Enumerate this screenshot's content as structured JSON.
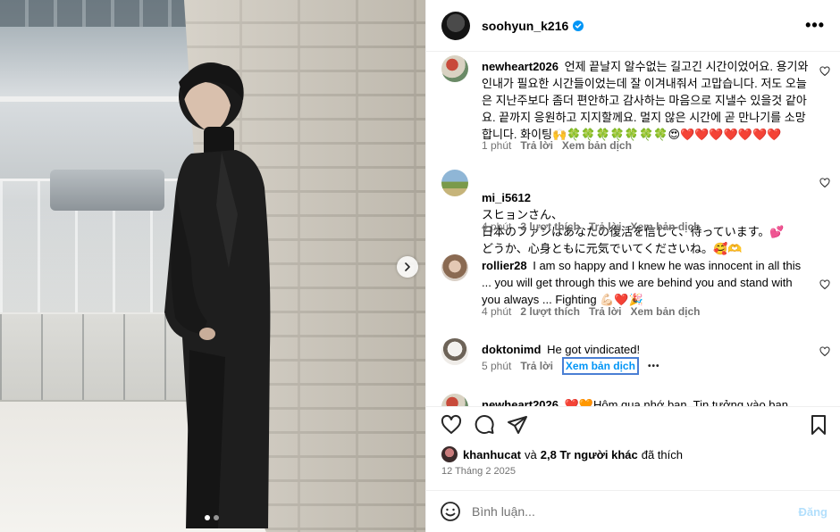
{
  "post": {
    "author": "soohyun_k216",
    "verified": true,
    "more_icon": "more-horizontal-icon",
    "carousel": {
      "slides": 2,
      "active": 0
    }
  },
  "comments": [
    {
      "username": "newheart2026",
      "text": "언제 끝날지 알수없는 길고긴 시간이었어요. 용기와 인내가 필요한 시간들이었는데 잘 이겨내줘서 고맙습니다. 저도 오늘은 지난주보다 좀더 편안하고 감사하는 마음으로 지낼수 있을것 같아요. 끝까지 응원하고 지지할께요. 멀지 않은 시간에 곧 만나기를 소망합니다. 화이팅🙌🍀🍀🍀🍀🍀🍀🍀😍❤️❤️❤️❤️❤️❤️❤️",
      "time": "1 phút",
      "likes": "",
      "reply": "Trả lời",
      "translate": "Xem bản dịch"
    },
    {
      "username": "mi_i5612",
      "text": "スヒョンさん、\n日本のファンはあなたの復活を信じて、待っています。💕\nどうか、心身ともに元気でいてくださいね。🥰🫶",
      "time": "4 phút",
      "likes": "3 lượt thích",
      "reply": "Trả lời",
      "translate": "Xem bản dịch"
    },
    {
      "username": "rollier28",
      "text": "I am so happy and I knew he was innocent in all this ... you will get through this we are behind you and stand with you always ... Fighting 💪🏻❤️🎉",
      "time": "4 phút",
      "likes": "2 lượt thích",
      "reply": "Trả lời",
      "translate": "Xem bản dịch"
    },
    {
      "username": "doktonimd",
      "text": "He got vindicated!",
      "time": "5 phút",
      "likes": "",
      "reply": "Trả lời",
      "translate": "Xem bản dịch",
      "more": "•••"
    },
    {
      "username": "newheart2026",
      "text": "❤️🧡Hôm qua nhớ bạn. Tin tưởng vào bạn",
      "time": "",
      "likes": "",
      "reply": "",
      "translate": ""
    }
  ],
  "likes": {
    "user": "khanhucat",
    "connector": "và",
    "others": "2,8 Tr người khác",
    "suffix": "đã thích"
  },
  "date": "12 Tháng 2 2025",
  "composer": {
    "placeholder": "Bình luận...",
    "post_label": "Đăng"
  },
  "icons": [
    "heart-icon",
    "comment-icon",
    "share-icon",
    "bookmark-icon",
    "emoji-icon",
    "verified-icon",
    "chevron-right-icon"
  ],
  "colors": {
    "link_blue": "#0095f6",
    "muted": "#737373",
    "post_disabled": "#b2dffc",
    "verified": "#0095f6"
  }
}
